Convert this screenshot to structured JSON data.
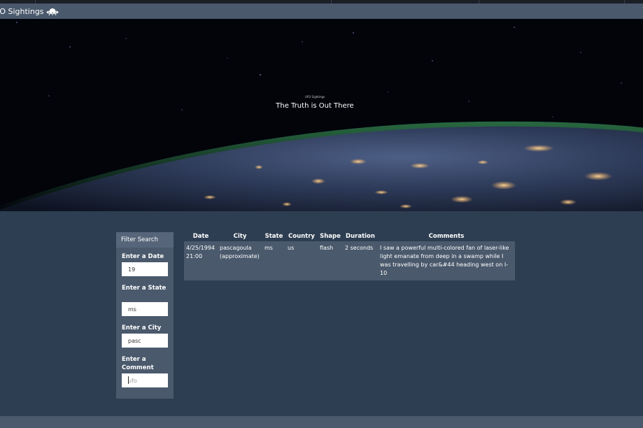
{
  "navbar": {
    "brand_label": "FO Sightings"
  },
  "hero": {
    "small_text": "UFO Sightings",
    "title": "The Truth is Out There"
  },
  "filter": {
    "header": "Filter Search",
    "fields": [
      {
        "label": "Enter a Date",
        "value": "19",
        "placeholder": ""
      },
      {
        "label": "Enter a State",
        "value": "ms",
        "placeholder": ""
      },
      {
        "label": "Enter a City",
        "value": "pasc",
        "placeholder": ""
      },
      {
        "label": "Enter a Comment",
        "value": "",
        "placeholder": "ufo"
      }
    ]
  },
  "table": {
    "headers": [
      "Date",
      "City",
      "State",
      "Country",
      "Shape",
      "Duration",
      "Comments"
    ],
    "rows": [
      {
        "date": "4/25/1994 21:00",
        "city": "pascagoula (approximate)",
        "state": "ms",
        "country": "us",
        "shape": "flash",
        "duration": "2 seconds",
        "comments": "I saw a powerful multi-colored fan of laser-like light emanate from deep in a swamp while I was travelling by car&#44 heading west on I-10"
      }
    ]
  },
  "colors": {
    "page_bg": "#2e3e52",
    "navbar_bg": "#4a596c",
    "panel_header_bg": "#56657a",
    "row_bg": "#4a596c"
  },
  "icons": {
    "brand": "ufo-icon"
  }
}
